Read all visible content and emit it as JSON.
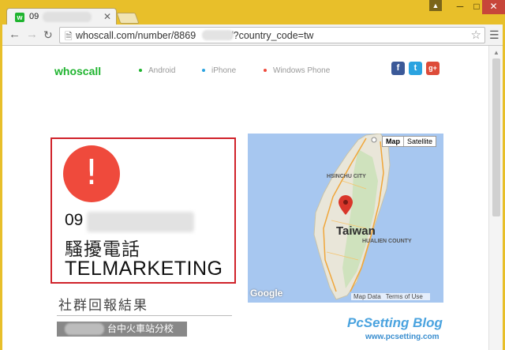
{
  "browser": {
    "tab_title": "09",
    "tab_favicon": "w",
    "close_glyph": "✕",
    "url": "whoscall.com/number/8869",
    "url_suffix": "/?country_code=tw",
    "user_icon": "▲",
    "min_glyph": "─",
    "max_glyph": "□",
    "close_window_glyph": "✕"
  },
  "site": {
    "logo": "whoscall",
    "nav": [
      {
        "label": "Android",
        "dot_color": "#1fb42f"
      },
      {
        "label": "iPhone",
        "dot_color": "#2ba3e0"
      },
      {
        "label": "Windows Phone",
        "dot_color": "#ef4a3c"
      }
    ],
    "social": {
      "facebook": "f",
      "twitter": "t",
      "googleplus": "g+"
    }
  },
  "result": {
    "alert_symbol": "!",
    "phone_prefix": "09",
    "label_zh": "騷擾電話",
    "label_en": "TELMARKETING"
  },
  "community": {
    "title": "社群回報結果",
    "report_text": "台中火車站分校"
  },
  "map": {
    "type_map": "Map",
    "type_satellite": "Satellite",
    "country_label": "Taiwan",
    "city_hsinchu": "HSINCHU CITY",
    "city_hualien": "HUALIEN COUNTY",
    "google": "Google",
    "map_data": "Map Data",
    "terms": "Terms of Use"
  },
  "watermark": {
    "title": "PcSetting Blog",
    "url": "www.pcsetting.com"
  },
  "colors": {
    "brand": "#1fb42f",
    "alert": "#ef4a3c",
    "highlight_border": "#d0222a"
  }
}
